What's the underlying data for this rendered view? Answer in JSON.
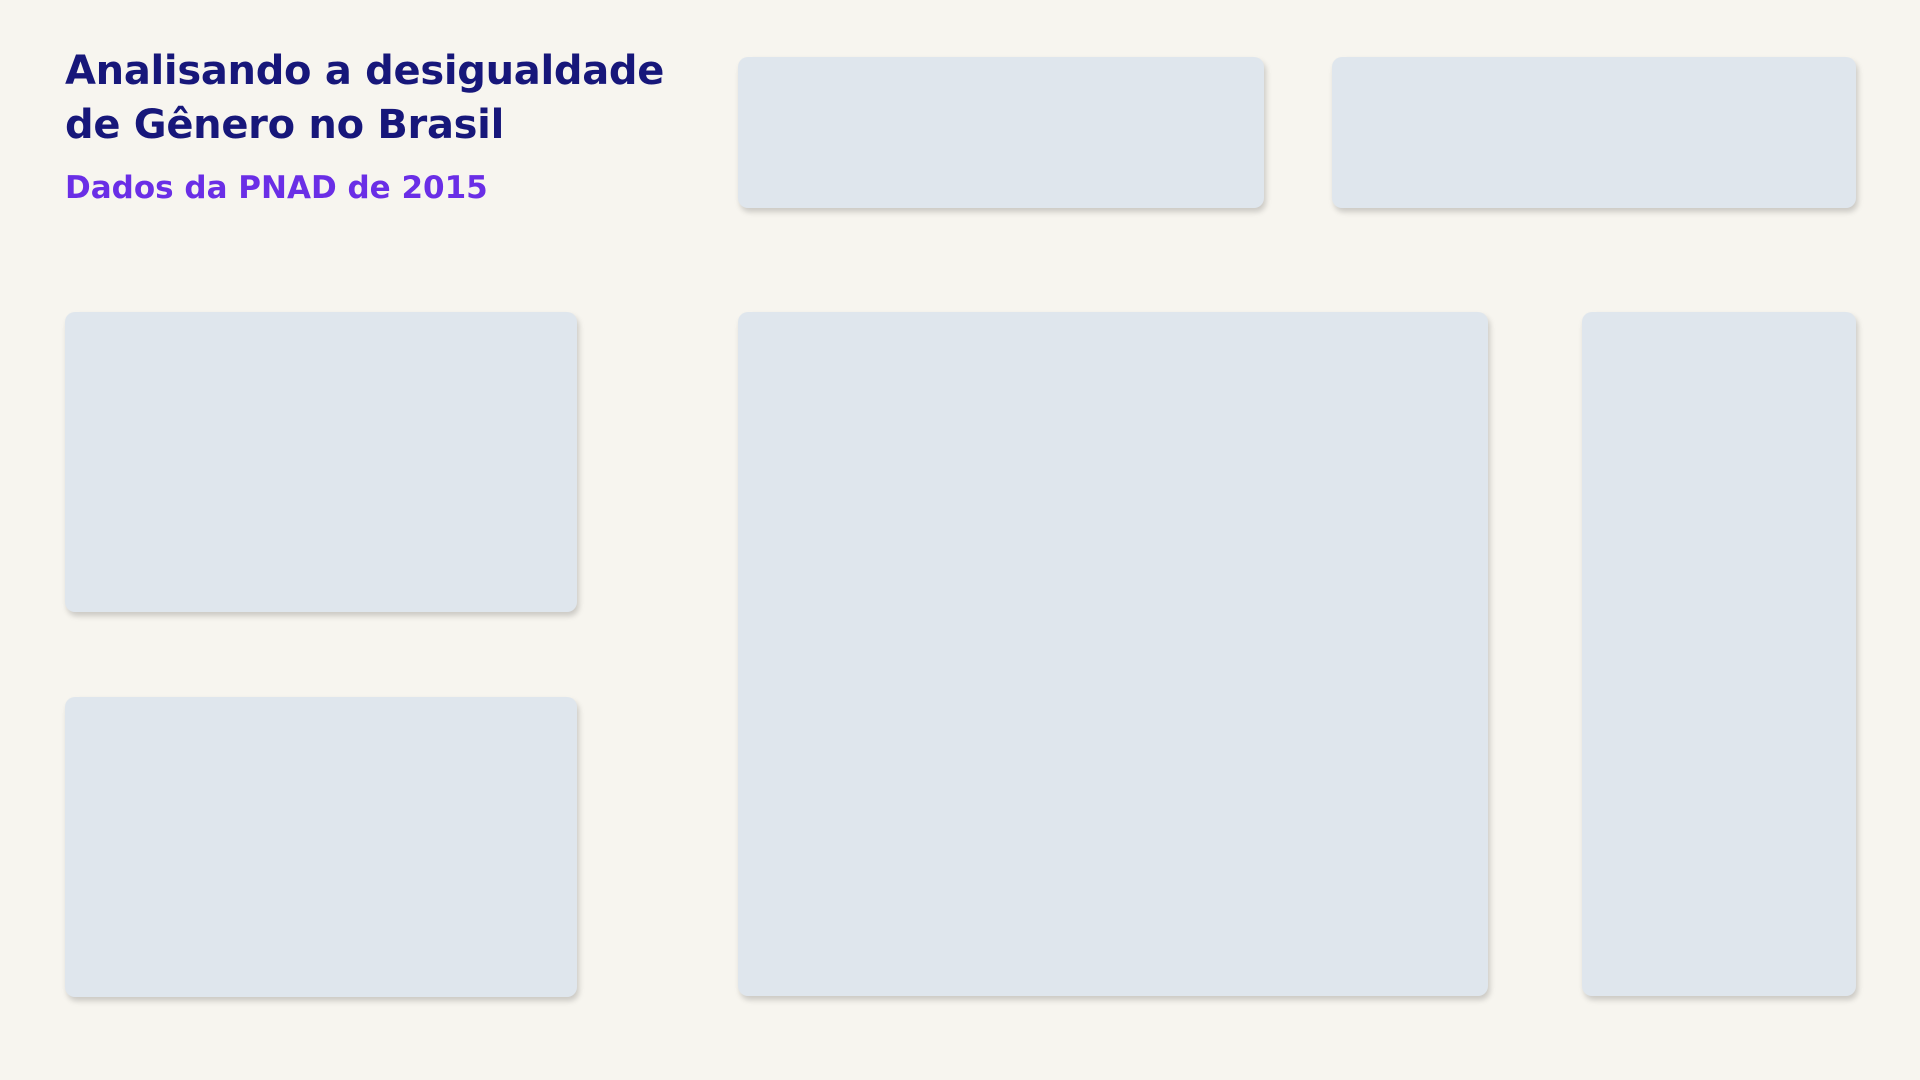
{
  "header": {
    "title": "Analisando a desigualdade de Gênero no Brasil",
    "subtitle": "Dados da PNAD de 2015"
  },
  "colors": {
    "background": "#f7f5ef",
    "title": "#17177a",
    "subtitle": "#6a2ee6",
    "card": "#dfe6ed"
  }
}
